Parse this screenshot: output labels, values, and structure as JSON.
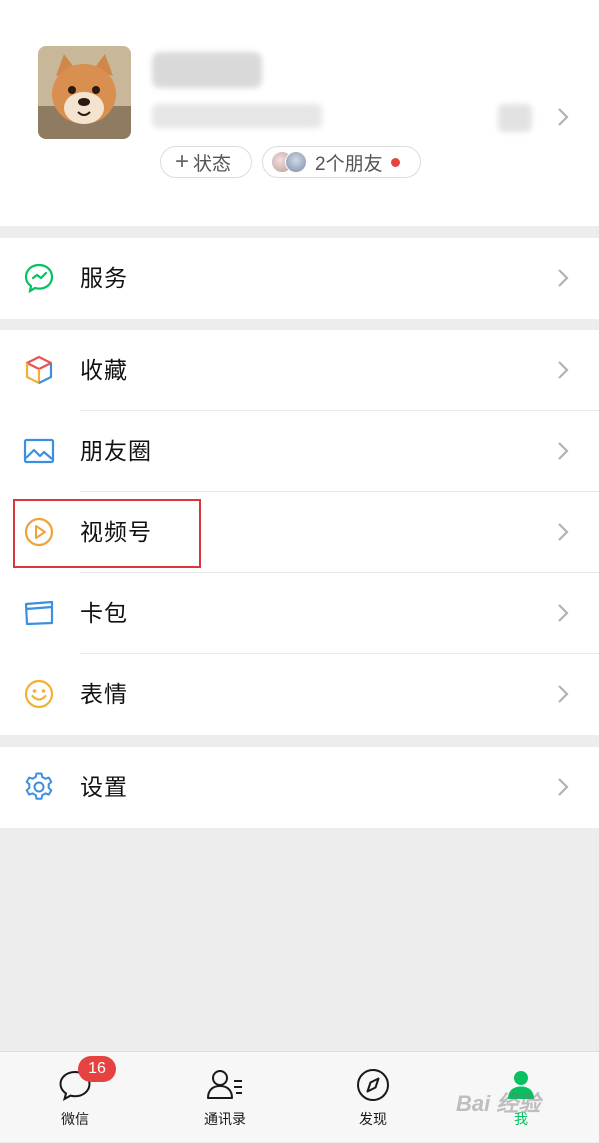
{
  "profile": {
    "status_label": "状态",
    "friends_label": "2个朋友"
  },
  "menu": {
    "services": "服务",
    "favorites": "收藏",
    "moments": "朋友圈",
    "channels": "视频号",
    "cards": "卡包",
    "stickers": "表情",
    "settings": "设置"
  },
  "tabbar": {
    "chats": "微信",
    "chats_badge": "16",
    "contacts": "通讯录",
    "discover": "发现",
    "me": "我"
  },
  "watermark": "Bai 经验",
  "colors": {
    "accent": "#07c160",
    "badge": "#e64340",
    "highlight_box": "#d9363e",
    "background": "#ededed"
  }
}
